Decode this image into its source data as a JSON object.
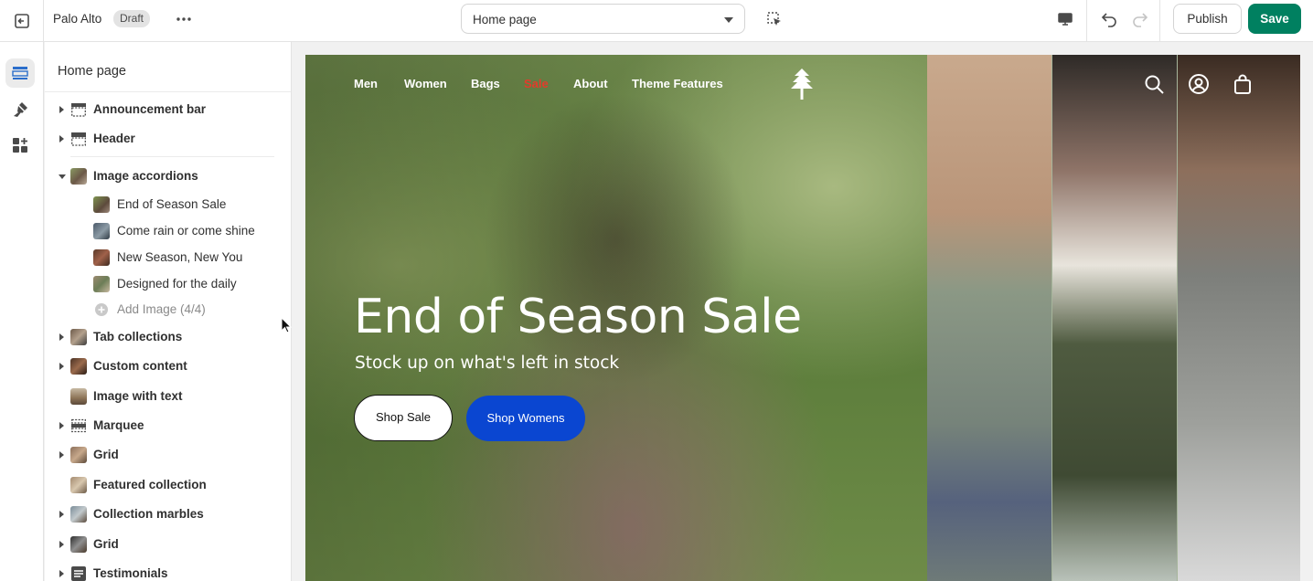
{
  "topbar": {
    "store_name": "Palo Alto",
    "status_badge": "Draft",
    "page_selector": "Home page",
    "publish_label": "Publish",
    "save_label": "Save",
    "save_color": "#008060"
  },
  "rail": {
    "items": [
      {
        "icon": "sections-icon",
        "active": true
      },
      {
        "icon": "theme-settings-brush-icon",
        "active": false
      },
      {
        "icon": "app-blocks-icon",
        "active": false
      }
    ]
  },
  "sidebar": {
    "title": "Home page",
    "sections": [
      {
        "label": "Announcement bar",
        "expandable": true,
        "icon": "announcement-bar-icon"
      },
      {
        "label": "Header",
        "expandable": true,
        "icon": "header-icon"
      },
      {
        "label": "Image accordions",
        "expandable": true,
        "expanded": true,
        "icon": "image-thumbnail",
        "children": [
          {
            "label": "End of Season Sale"
          },
          {
            "label": "Come rain or come shine"
          },
          {
            "label": "New Season, New You"
          },
          {
            "label": "Designed for the daily"
          },
          {
            "label": "Add Image (4/4)",
            "disabled": true
          }
        ]
      },
      {
        "label": "Tab collections",
        "expandable": true,
        "icon": "image-thumbnail"
      },
      {
        "label": "Custom content",
        "expandable": true,
        "icon": "image-thumbnail"
      },
      {
        "label": "Image with text",
        "expandable": false,
        "icon": "image-thumbnail"
      },
      {
        "label": "Marquee",
        "expandable": true,
        "icon": "marquee-icon"
      },
      {
        "label": "Grid",
        "expandable": true,
        "icon": "image-thumbnail"
      },
      {
        "label": "Featured collection",
        "expandable": false,
        "icon": "image-thumbnail"
      },
      {
        "label": "Collection marbles",
        "expandable": true,
        "icon": "image-thumbnail"
      },
      {
        "label": "Grid",
        "expandable": true,
        "icon": "image-thumbnail"
      },
      {
        "label": "Testimonials",
        "expandable": true,
        "icon": "text-lines-icon"
      }
    ]
  },
  "preview": {
    "nav": [
      "Men",
      "Women",
      "Bags",
      "Sale",
      "About",
      "Theme Features"
    ],
    "nav_sale_color": "#e23c2b",
    "hero_title": "End of Season Sale",
    "hero_subtitle": "Stock up on what's left in stock",
    "primary_button": "Shop Sale",
    "secondary_button": "Shop Womens",
    "secondary_button_color": "#0a46d1"
  }
}
